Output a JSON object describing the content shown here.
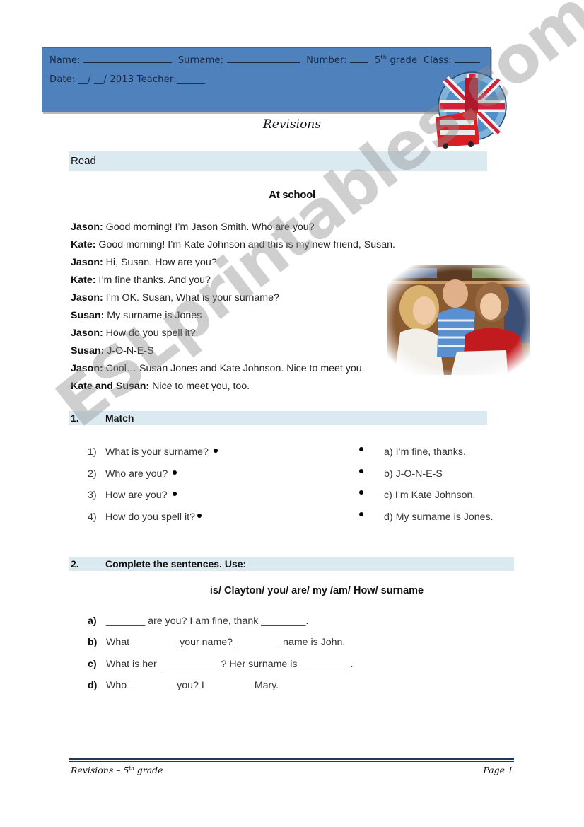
{
  "header": {
    "name_label": "Name:",
    "surname_label": "Surname:",
    "number_label": "Number:",
    "grade_num": "5",
    "grade_sup": "th",
    "grade_label": "grade",
    "class_label": "Class:",
    "date_label": "Date: __/ __/ 2013",
    "teacher_label": "Teacher:______"
  },
  "title": "Revisions",
  "read_section": {
    "label": "Read",
    "subtitle": "At school",
    "dialog": [
      {
        "speaker": "Jason:",
        "text": " Good morning! I’m Jason Smith. Who are you?"
      },
      {
        "speaker": "Kate:",
        "text": " Good morning! I’m Kate Johnson and this is my new friend, Susan."
      },
      {
        "speaker": "Jason:",
        "text": " Hi, Susan. How are you?"
      },
      {
        "speaker": "Kate:",
        "text": " I’m fine thanks. And you?"
      },
      {
        "speaker": "Jason:",
        "text": " I’m OK. Susan, What is your surname?"
      },
      {
        "speaker": "Susan:",
        "text": " My surname is Jones ."
      },
      {
        "speaker": "Jason:",
        "text": " How do you spell it?"
      },
      {
        "speaker": "Susan:",
        "text": " J-O-N-E-S"
      },
      {
        "speaker": "Jason:",
        "text": " Cool… Susan Jones and Kate Johnson. Nice to meet you."
      },
      {
        "speaker": "Kate and Susan:",
        "text": " Nice to meet you, too."
      }
    ]
  },
  "exercise1": {
    "number": "1.",
    "label": "Match",
    "questions": [
      {
        "n": "1)",
        "text": "What is your surname?"
      },
      {
        "n": "2)",
        "text": "Who are you?"
      },
      {
        "n": "3)",
        "text": "How are you?"
      },
      {
        "n": "4)",
        "text": "How do you spell it?"
      }
    ],
    "answers": [
      {
        "n": "a)",
        "text": "I’m fine, thanks."
      },
      {
        "n": "b)",
        "text": "J-O-N-E-S"
      },
      {
        "n": "c)",
        "text": "I’m Kate Johnson."
      },
      {
        "n": "d)",
        "text": "My surname is Jones."
      }
    ]
  },
  "exercise2": {
    "number": "2.",
    "label": "Complete the sentences. Use:",
    "word_bank": "is/ Clayton/ you/ are/ my /am/ How/ surname",
    "sentences": [
      {
        "n": "a)",
        "text": "_______ are you? I am fine, thank ________."
      },
      {
        "n": "b)",
        "text": "What ________ your name? ________ name is John."
      },
      {
        "n": "c)",
        "text": "What is her ___________? Her surname is _________."
      },
      {
        "n": "d)",
        "text": "Who ________ you? I ________ Mary."
      }
    ]
  },
  "footer": {
    "left": "Revisions – 5",
    "left_sup": "th",
    "left_suffix": " grade",
    "right": "Page 1"
  },
  "watermark": "ESLprintables.com",
  "colors": {
    "header_bg": "#4f81bd",
    "section_bar": "#dbeaf1",
    "footer_rule": "#1f3b5a"
  }
}
